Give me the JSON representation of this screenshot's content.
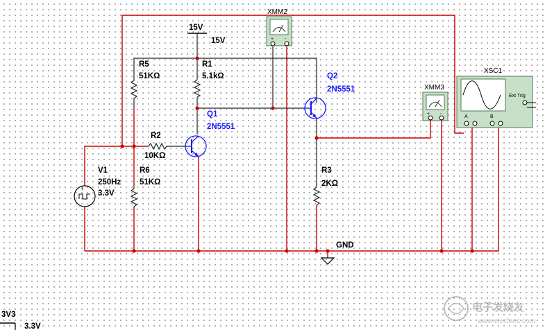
{
  "components": {
    "vcc_top": {
      "name": "15V",
      "value": "15V"
    },
    "xmm2": {
      "label": "XMM2",
      "plus": "+",
      "minus": "-"
    },
    "xmm3": {
      "label": "XMM3",
      "plus": "+",
      "minus": "-"
    },
    "xsc1": {
      "label": "XSC1",
      "ext_trig": "Ext Trig",
      "ch_a": "A",
      "ch_b": "B"
    },
    "r5": {
      "name": "R5",
      "value": "51KΩ"
    },
    "r1": {
      "name": "R1",
      "value": "5.1kΩ"
    },
    "r2": {
      "name": "R2",
      "value": "10KΩ"
    },
    "r6": {
      "name": "R6",
      "value": "51KΩ"
    },
    "r3": {
      "name": "R3",
      "value": "2KΩ"
    },
    "q1": {
      "name": "Q1",
      "model": "2N5551"
    },
    "q2": {
      "name": "Q2",
      "model": "2N5551"
    },
    "v1": {
      "name": "V1",
      "freq": "250Hz",
      "amp": "3.3V"
    },
    "gnd": {
      "label": "GND"
    },
    "v3v3": {
      "name": "3V3",
      "value": "3.3V"
    }
  },
  "watermark": {
    "text": "电子发烧友",
    "url": "www.elecfans.com"
  },
  "colors": {
    "wire": "#cc0000",
    "wire_alt": "#222222",
    "transistor": "#1a1aff",
    "instrument": "#c8e0c8"
  }
}
